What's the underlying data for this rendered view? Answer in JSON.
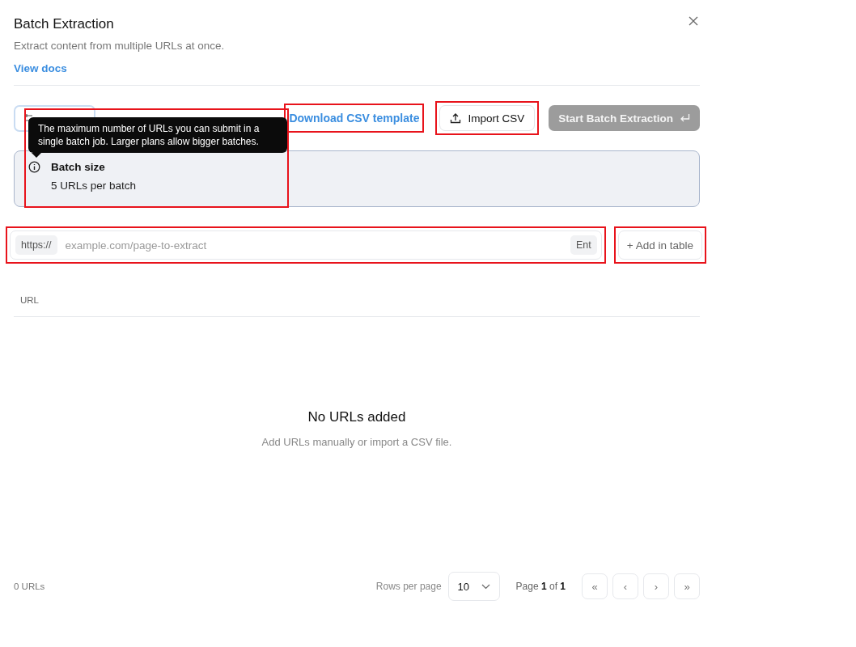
{
  "dialog": {
    "title": "Batch Extraction",
    "subtitle": "Extract content from multiple URLs at once.",
    "docs_link": "View docs"
  },
  "toolbar": {
    "download_link": {
      "label": "Download CSV template",
      "highlighted": true
    },
    "import_button": {
      "label": "Import CSV",
      "highlighted": true
    },
    "start_button": {
      "label": "Start Batch Extraction",
      "disabled": true
    }
  },
  "tooltip": {
    "text": "The maximum number of URLs you can submit in a single batch job. Larger plans allow bigger batches.",
    "highlighted": true
  },
  "info": {
    "title": "Batch size",
    "value": "5 URLs per batch"
  },
  "url_input": {
    "prefix": "https://",
    "placeholder": "example.com/page-to-extract",
    "key_hint": "Ent",
    "highlighted": true
  },
  "add_button": {
    "label": "+ Add in table",
    "highlighted": true
  },
  "table": {
    "columns": [
      "URL"
    ],
    "empty_title": "No URLs added",
    "empty_text": "Add URLs manually or import a CSV file."
  },
  "footer": {
    "count": "0 URLs",
    "rows_label": "Rows per page",
    "rows_value": "10",
    "page_label": "Page **1** of **1**",
    "nav": [
      "«",
      "‹",
      "›",
      "»"
    ]
  }
}
